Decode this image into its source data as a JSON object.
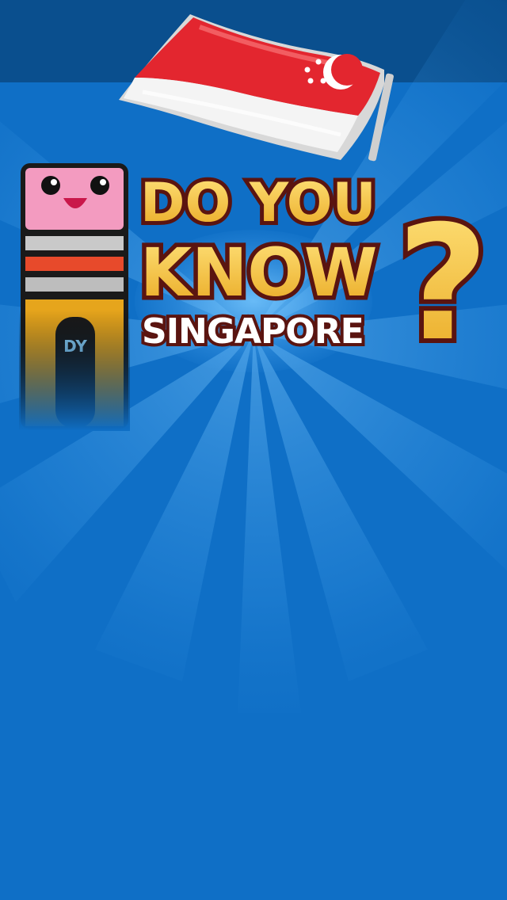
{
  "game": {
    "title_line1": "DO YOU",
    "title_line2": "KNOW",
    "title_mark": "?",
    "subtitle": "SINGAPORE",
    "mascot_label": "DY"
  },
  "colors": {
    "background": "#0f6fc6",
    "top_band": "#0a4f8e",
    "flag_red": "#e3262f",
    "flag_white": "#f4f4f4",
    "title_gold": "#f6c431",
    "title_outline": "#5a1410",
    "subtitle_fill": "#ffffff",
    "mascot_pink": "#f39bc0"
  },
  "icons": [
    "singapore-flag-icon",
    "pink-block-mascot-icon"
  ]
}
